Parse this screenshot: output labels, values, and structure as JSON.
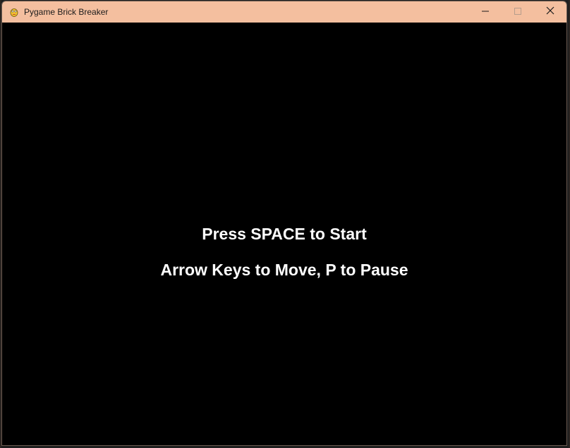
{
  "window": {
    "title": "Pygame Brick Breaker",
    "app_icon": "pygame-snake-icon",
    "controls": {
      "minimize_icon": "minimize-icon",
      "maximize_icon": "maximize-icon",
      "close_icon": "close-icon"
    },
    "titlebar_color": "#f4bf9f"
  },
  "game": {
    "background_color": "#000000",
    "text_color": "#ffffff",
    "start_message": "Press SPACE to Start",
    "help_message": "Arrow Keys to Move, P to Pause"
  }
}
